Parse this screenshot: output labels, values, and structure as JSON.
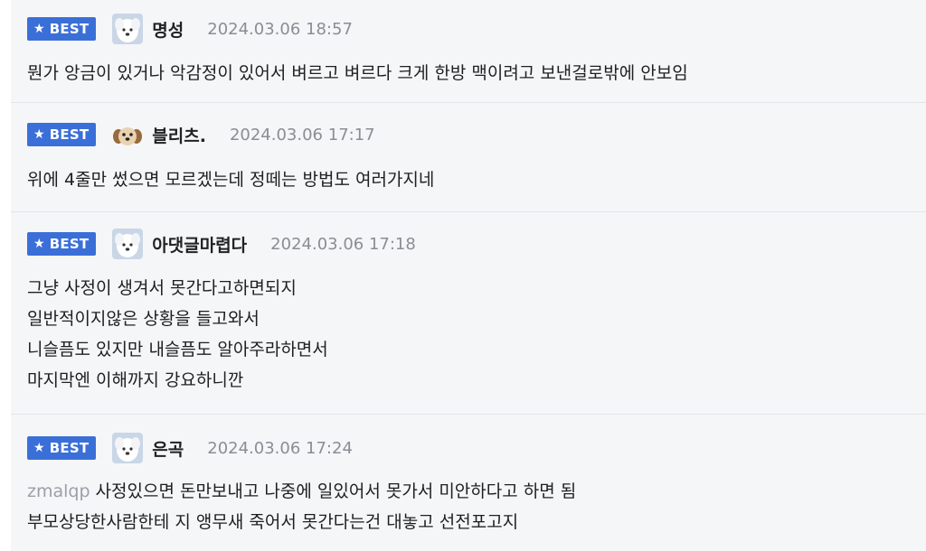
{
  "badge_label": "BEST",
  "colors": {
    "badge_bg": "#3b6fd8",
    "background": "#f5f6f8",
    "date_text": "#8a8d93",
    "mention_text": "#9aa0a8"
  },
  "comments": [
    {
      "avatar_icon": "white-dog-avatar-icon",
      "nickname": "명성",
      "date": "2024.03.06 18:57",
      "lines": [
        "뭔가 앙금이 있거나 악감정이 있어서 벼르고 벼르다 크게 한방 맥이려고 보낸걸로밖에 안보임"
      ]
    },
    {
      "avatar_icon": "puppy-face-avatar-icon",
      "nickname": "블리츠.",
      "date": "2024.03.06 17:17",
      "lines": [
        "위에 4줄만 썼으면 모르겠는데 정떼는 방법도 여러가지네"
      ]
    },
    {
      "avatar_icon": "white-dog-avatar-icon",
      "nickname": "아댓글마렵다",
      "date": "2024.03.06 17:18",
      "lines": [
        "그냥 사정이 생겨서 못간다고하면되지",
        "일반적이지않은 상황을 들고와서",
        "니슬픔도 있지만 내슬픔도 알아주라하면서",
        "마지막엔 이해까지 강요하니깐"
      ]
    },
    {
      "avatar_icon": "white-dog-avatar-icon",
      "nickname": "은곡",
      "date": "2024.03.06 17:24",
      "mention": "zmalqp",
      "lines": [
        "사정있으면 돈만보내고 나중에 일있어서 못가서 미안하다고 하면 됨",
        "부모상당한사람한테 지 앵무새 죽어서 못간다는건 대놓고 선전포고지"
      ]
    }
  ]
}
